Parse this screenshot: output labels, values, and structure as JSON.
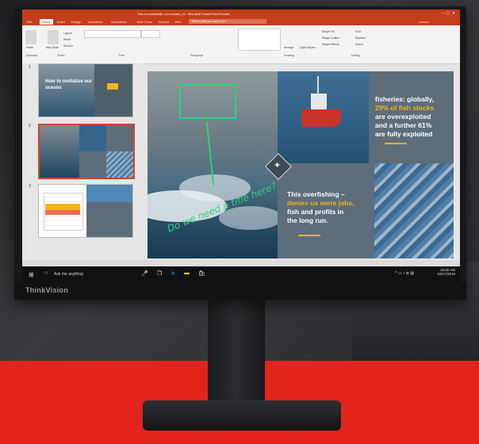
{
  "monitor": {
    "brand": "ThinkVision"
  },
  "powerpoint": {
    "title": "How to accelerate: our oceans_v3 - Microsoft PowerPoint Preview",
    "tabs": [
      "File",
      "Home",
      "Insert",
      "Design",
      "Transitions",
      "Animations",
      "Slide Show",
      "Review",
      "View"
    ],
    "active_tab": "Home",
    "tell_me": "Tell me what you want to do",
    "ribbon_groups": [
      "Clipboard",
      "Slides",
      "Font",
      "Paragraph",
      "Drawing",
      "Editing"
    ],
    "ribbon_buttons": {
      "paste": "Paste",
      "new_slide": "New Slide",
      "layout": "Layout",
      "reset": "Reset",
      "section": "Section",
      "arrange": "Arrange",
      "quick_styles": "Quick Styles",
      "shape_fill": "Shape Fill",
      "shape_outline": "Shape Outline",
      "shape_effects": "Shape Effects",
      "find": "Find",
      "replace": "Replace",
      "select": "Select"
    },
    "user": "Lenovo"
  },
  "thumbnails": [
    {
      "number": "1",
      "text": "How to revitalise our oceans"
    },
    {
      "number": "2",
      "text": ""
    },
    {
      "number": "3",
      "text": ""
    }
  ],
  "slide": {
    "handwriting": "Do we need a title here?",
    "right_text": [
      "fisheries: globally,",
      "29% of fish stocks",
      "are overexploited",
      "and a further 61%",
      "are fully exploited"
    ],
    "left_text": [
      "This overfishing –",
      "denies us more jobs,",
      "fish and profits in",
      "the long run."
    ]
  },
  "taskbar": {
    "search": "Ask me anything",
    "time": "10:00 AM",
    "date": "03/17/2019"
  },
  "colors": {
    "accent": "#c43e1c",
    "highlight": "#f5b51f",
    "red_floor": "#e2241c",
    "ink": "#2fd17a"
  }
}
